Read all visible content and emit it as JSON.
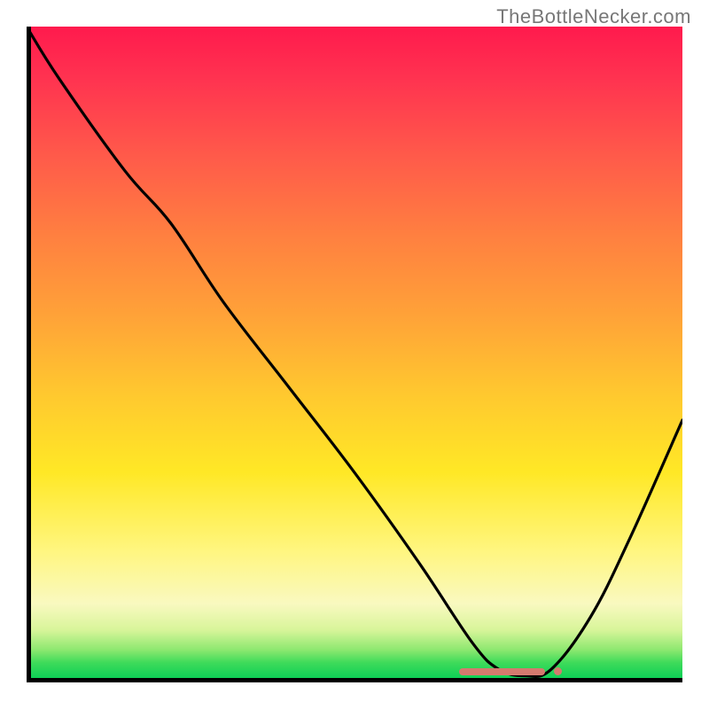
{
  "watermark": "TheBottleNecker.com",
  "chart_data": {
    "type": "line",
    "title": "",
    "xlabel": "",
    "ylabel": "",
    "xlim": [
      0,
      100
    ],
    "ylim": [
      0,
      100
    ],
    "background": "vertical-gradient red-to-green (bottleneck severity)",
    "series": [
      {
        "name": "bottleneck-curve",
        "x": [
          0,
          5,
          15,
          22,
          30,
          40,
          50,
          60,
          68,
          72,
          76,
          80,
          86,
          92,
          100
        ],
        "values": [
          100,
          92,
          78,
          70,
          58,
          45,
          32,
          18,
          6,
          2,
          1,
          2,
          10,
          22,
          40
        ]
      }
    ],
    "optimal_range_marker": {
      "x_start": 66,
      "x_end": 79,
      "dot_x": 81
    },
    "colors": {
      "curve": "#000000",
      "marker": "#d47a6e",
      "gradient_top": "#ff1a4d",
      "gradient_bottom": "#00cc55"
    }
  }
}
